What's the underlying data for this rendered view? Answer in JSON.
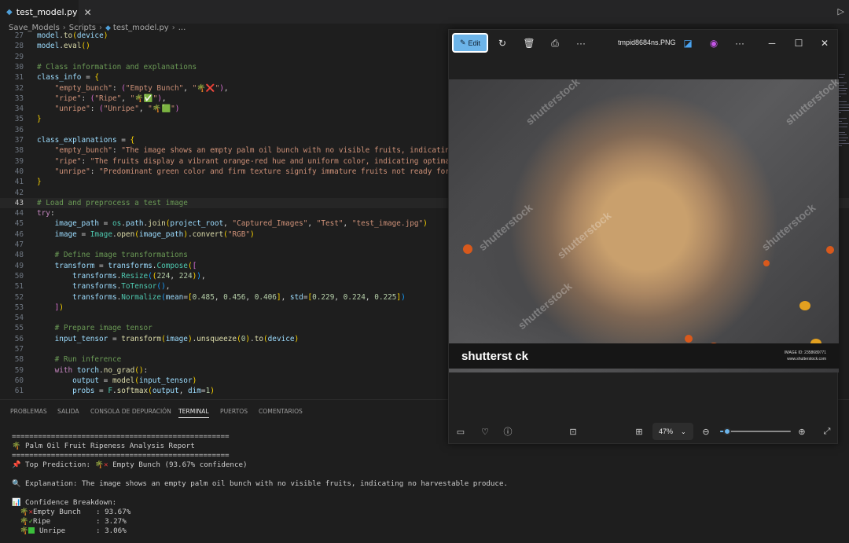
{
  "editor": {
    "tab_label": "test_model.py",
    "breadcrumb": [
      "Save_Models",
      "Scripts",
      "test_model.py",
      "..."
    ],
    "lines": [
      {
        "n": "27",
        "code": [
          [
            "var",
            "model"
          ],
          [
            "",
            "."
          ],
          [
            "fn",
            "to"
          ],
          [
            "br1",
            "("
          ],
          [
            "var",
            "device"
          ],
          [
            "br1",
            ")"
          ]
        ]
      },
      {
        "n": "28",
        "code": [
          [
            "var",
            "model"
          ],
          [
            "",
            "."
          ],
          [
            "fn",
            "eval"
          ],
          [
            "br1",
            "()"
          ]
        ]
      },
      {
        "n": "29",
        "code": []
      },
      {
        "n": "30",
        "code": [
          [
            "cmt",
            "# Class information and explanations"
          ]
        ]
      },
      {
        "n": "31",
        "code": [
          [
            "var",
            "class_info"
          ],
          [
            "",
            " = "
          ],
          [
            "br1",
            "{"
          ]
        ]
      },
      {
        "n": "32",
        "code": [
          [
            "",
            " "
          ],
          [
            "str",
            "\"empty_bunch\""
          ],
          [
            "",
            ": "
          ],
          [
            "br2",
            "("
          ],
          [
            "str",
            "\"Empty Bunch\""
          ],
          [
            "",
            ", "
          ],
          [
            "str",
            "\"🌴❌\""
          ],
          [
            "br2",
            ")"
          ],
          [
            "",
            ","
          ]
        ]
      },
      {
        "n": "33",
        "code": [
          [
            "",
            " "
          ],
          [
            "str",
            "\"ripe\""
          ],
          [
            "",
            ": "
          ],
          [
            "br2",
            "("
          ],
          [
            "str",
            "\"Ripe\""
          ],
          [
            "",
            ", "
          ],
          [
            "str",
            "\"🌴✅\""
          ],
          [
            "br2",
            ")"
          ],
          [
            "",
            ","
          ]
        ]
      },
      {
        "n": "34",
        "code": [
          [
            "",
            " "
          ],
          [
            "str",
            "\"unripe\""
          ],
          [
            "",
            ": "
          ],
          [
            "br2",
            "("
          ],
          [
            "str",
            "\"Unripe\""
          ],
          [
            "",
            ", "
          ],
          [
            "str",
            "\"🌴🟩\""
          ],
          [
            "br2",
            ")"
          ]
        ]
      },
      {
        "n": "35",
        "code": [
          [
            "br1",
            "}"
          ]
        ]
      },
      {
        "n": "36",
        "code": []
      },
      {
        "n": "37",
        "code": [
          [
            "var",
            "class_explanations"
          ],
          [
            "",
            " = "
          ],
          [
            "br1",
            "{"
          ]
        ]
      },
      {
        "n": "38",
        "code": [
          [
            "",
            " "
          ],
          [
            "str",
            "\"empty_bunch\""
          ],
          [
            "",
            ": "
          ],
          [
            "str",
            "\"The image shows an empty palm oil bunch with no visible fruits, indicating no"
          ]
        ]
      },
      {
        "n": "39",
        "code": [
          [
            "",
            " "
          ],
          [
            "str",
            "\"ripe\""
          ],
          [
            "",
            ": "
          ],
          [
            "str",
            "\"The fruits display a vibrant orange-red hue and uniform color, indicating optimal ri"
          ]
        ]
      },
      {
        "n": "40",
        "code": [
          [
            "",
            " "
          ],
          [
            "str",
            "\"unripe\""
          ],
          [
            "",
            ": "
          ],
          [
            "str",
            "\"Predominant green color and firm texture signify immature fruits not ready for har"
          ]
        ]
      },
      {
        "n": "41",
        "code": [
          [
            "br1",
            "}"
          ]
        ]
      },
      {
        "n": "42",
        "code": []
      },
      {
        "n": "43",
        "code": [
          [
            "cmt",
            "# Load and preprocess a test image"
          ]
        ],
        "current": true
      },
      {
        "n": "44",
        "code": [
          [
            "kw",
            "try"
          ],
          [
            "",
            ":"
          ]
        ]
      },
      {
        "n": "45",
        "code": [
          [
            "",
            " "
          ],
          [
            "var",
            "image_path"
          ],
          [
            "",
            " = "
          ],
          [
            "cls",
            "os"
          ],
          [
            "",
            "."
          ],
          [
            "var",
            "path"
          ],
          [
            "",
            "."
          ],
          [
            "fn",
            "join"
          ],
          [
            "br1",
            "("
          ],
          [
            "var",
            "project_root"
          ],
          [
            "",
            ", "
          ],
          [
            "str",
            "\"Captured_Images\""
          ],
          [
            "",
            ", "
          ],
          [
            "str",
            "\"Test\""
          ],
          [
            "",
            ", "
          ],
          [
            "str",
            "\"test_image.jpg\""
          ],
          [
            "br1",
            ")"
          ]
        ]
      },
      {
        "n": "46",
        "code": [
          [
            "",
            " "
          ],
          [
            "var",
            "image"
          ],
          [
            "",
            " = "
          ],
          [
            "cls",
            "Image"
          ],
          [
            "",
            "."
          ],
          [
            "fn",
            "open"
          ],
          [
            "br1",
            "("
          ],
          [
            "var",
            "image_path"
          ],
          [
            "br1",
            ")"
          ],
          [
            "",
            "."
          ],
          [
            "fn",
            "convert"
          ],
          [
            "br1",
            "("
          ],
          [
            "str",
            "\"RGB\""
          ],
          [
            "br1",
            ")"
          ]
        ]
      },
      {
        "n": "47",
        "code": []
      },
      {
        "n": "48",
        "code": [
          [
            "",
            " "
          ],
          [
            "cmt",
            "# Define image transformations"
          ]
        ]
      },
      {
        "n": "49",
        "code": [
          [
            "",
            " "
          ],
          [
            "var",
            "transform"
          ],
          [
            "",
            " = "
          ],
          [
            "var",
            "transforms"
          ],
          [
            "",
            "."
          ],
          [
            "cls",
            "Compose"
          ],
          [
            "br1",
            "("
          ],
          [
            "br2",
            "["
          ]
        ]
      },
      {
        "n": "50",
        "code": [
          [
            "",
            " "
          ],
          [
            "var",
            "transforms"
          ],
          [
            "",
            "."
          ],
          [
            "cls",
            "Resize"
          ],
          [
            "br3",
            "("
          ],
          [
            "br1",
            "("
          ],
          [
            "num",
            "224"
          ],
          [
            "",
            ", "
          ],
          [
            "num",
            "224"
          ],
          [
            "br1",
            ")"
          ],
          [
            "br3",
            ")"
          ],
          [
            "",
            ","
          ]
        ]
      },
      {
        "n": "51",
        "code": [
          [
            "",
            " "
          ],
          [
            "var",
            "transforms"
          ],
          [
            "",
            "."
          ],
          [
            "cls",
            "ToTensor"
          ],
          [
            "br3",
            "()"
          ],
          [
            "",
            ","
          ]
        ]
      },
      {
        "n": "52",
        "code": [
          [
            "",
            " "
          ],
          [
            "var",
            "transforms"
          ],
          [
            "",
            "."
          ],
          [
            "cls",
            "Normalize"
          ],
          [
            "br3",
            "("
          ],
          [
            "var",
            "mean"
          ],
          [
            "",
            "="
          ],
          [
            "br1",
            "["
          ],
          [
            "num",
            "0.485"
          ],
          [
            "",
            ", "
          ],
          [
            "num",
            "0.456"
          ],
          [
            "",
            ", "
          ],
          [
            "num",
            "0.406"
          ],
          [
            "br1",
            "]"
          ],
          [
            "",
            ", "
          ],
          [
            "var",
            "std"
          ],
          [
            "",
            "="
          ],
          [
            "br1",
            "["
          ],
          [
            "num",
            "0.229"
          ],
          [
            "",
            ", "
          ],
          [
            "num",
            "0.224"
          ],
          [
            "",
            ", "
          ],
          [
            "num",
            "0.225"
          ],
          [
            "br1",
            "]"
          ],
          [
            "br3",
            ")"
          ]
        ]
      },
      {
        "n": "53",
        "code": [
          [
            "",
            " "
          ],
          [
            "br2",
            "]"
          ],
          [
            "br1",
            ")"
          ]
        ]
      },
      {
        "n": "54",
        "code": []
      },
      {
        "n": "55",
        "code": [
          [
            "",
            " "
          ],
          [
            "cmt",
            "# Prepare image tensor"
          ]
        ]
      },
      {
        "n": "56",
        "code": [
          [
            "",
            " "
          ],
          [
            "var",
            "input_tensor"
          ],
          [
            "",
            " = "
          ],
          [
            "fn",
            "transform"
          ],
          [
            "br1",
            "("
          ],
          [
            "var",
            "image"
          ],
          [
            "br1",
            ")"
          ],
          [
            "",
            "."
          ],
          [
            "fn",
            "unsqueeze"
          ],
          [
            "br1",
            "("
          ],
          [
            "num",
            "0"
          ],
          [
            "br1",
            ")"
          ],
          [
            "",
            "."
          ],
          [
            "fn",
            "to"
          ],
          [
            "br1",
            "("
          ],
          [
            "var",
            "device"
          ],
          [
            "br1",
            ")"
          ]
        ]
      },
      {
        "n": "57",
        "code": []
      },
      {
        "n": "58",
        "code": [
          [
            "",
            " "
          ],
          [
            "cmt",
            "# Run inference"
          ]
        ]
      },
      {
        "n": "59",
        "code": [
          [
            "",
            " "
          ],
          [
            "kw",
            "with"
          ],
          [
            "",
            " "
          ],
          [
            "var",
            "torch"
          ],
          [
            "",
            "."
          ],
          [
            "fn",
            "no_grad"
          ],
          [
            "br1",
            "()"
          ],
          [
            "",
            ":"
          ]
        ]
      },
      {
        "n": "60",
        "code": [
          [
            "",
            " "
          ],
          [
            "var",
            "output"
          ],
          [
            "",
            " = "
          ],
          [
            "fn",
            "model"
          ],
          [
            "br1",
            "("
          ],
          [
            "var",
            "input_tensor"
          ],
          [
            "br1",
            ")"
          ]
        ]
      },
      {
        "n": "61",
        "code": [
          [
            "",
            " "
          ],
          [
            "var",
            "probs"
          ],
          [
            "",
            " = "
          ],
          [
            "cls",
            "F"
          ],
          [
            "",
            "."
          ],
          [
            "fn",
            "softmax"
          ],
          [
            "br1",
            "("
          ],
          [
            "var",
            "output"
          ],
          [
            "",
            ", "
          ],
          [
            "var",
            "dim"
          ],
          [
            "",
            "="
          ],
          [
            "num",
            "1"
          ],
          [
            "br1",
            ")"
          ]
        ]
      }
    ]
  },
  "panel_tabs": [
    "PROBLEMAS",
    "SALIDA",
    "CONSOLA DE DEPURACIÓN",
    "TERMINAL",
    "PUERTOS",
    "COMENTARIOS"
  ],
  "terminal": {
    "rule": "==================================================",
    "title": "Palm Oil Fruit Ripeness Analysis Report",
    "top_prediction_label": "Top Prediction:",
    "top_prediction_value": "Empty Bunch (93.67% confidence)",
    "explanation_label": "Explanation:",
    "explanation_text": "The image shows an empty palm oil bunch with no visible fruits, indicating no harvestable produce.",
    "breakdown_label": "Confidence Breakdown:",
    "breakdown": [
      {
        "name": "Empty Bunch",
        "value": ": 93.67%",
        "icon": "x"
      },
      {
        "name": "Ripe",
        "value": ": 3.27%",
        "icon": "check"
      },
      {
        "name": "Unripe",
        "value": ": 3.06%",
        "icon": "square"
      }
    ]
  },
  "viewer": {
    "edit_label": "Edit",
    "filename": "tmpid8684ns.PNG",
    "watermark": "shutterstock",
    "footer_logo": "shutterst ck",
    "footer_id": "IMAGE ID: 2358689771",
    "footer_site": "www.shutterstock.com",
    "zoom_label": "47%",
    "zoom_fraction": 0.1
  },
  "colors": {
    "accent": "#6cb4e9",
    "editor_bg": "#1e1e1e"
  }
}
